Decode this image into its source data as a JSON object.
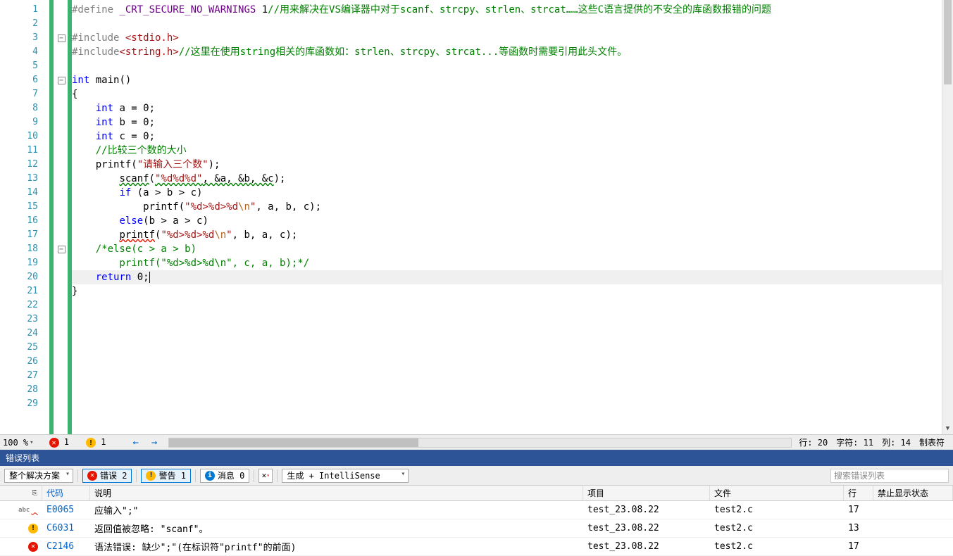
{
  "code": {
    "lines": 29
  },
  "code_tokens": {
    "l1": {
      "define": "#define ",
      "macro": "_CRT_SECURE_NO_WARNINGS",
      "one": " 1",
      "cmt": "//用来解决在VS编译器中对于scanf、strcpy、strlen、strcat……这些C语言提供的不安全的库函数报错的问题"
    },
    "l3": {
      "inc": "#include ",
      "hdr": "<stdio.h>"
    },
    "l4": {
      "inc": "#include",
      "hdr": "<string.h>",
      "cmt": "//这里在使用string相关的库函数如：strlen、strcpy、strcat...等函数时需要引用此头文件。"
    },
    "l6": {
      "int": "int",
      "main": " main()"
    },
    "l7": {
      "brace": "{"
    },
    "l8": {
      "int": "int",
      "rest": " a = 0;"
    },
    "l9": {
      "int": "int",
      "rest": " b = 0;"
    },
    "l10": {
      "int": "int",
      "rest": " c = 0;"
    },
    "l11": {
      "cmt": "//比较三个数的大小"
    },
    "l12": {
      "fn": "printf(",
      "str": "\"请输入三个数\"",
      "end": ");"
    },
    "l13": {
      "scanf": "scanf",
      "paren": "(",
      "fmt": "\"%d%d%d\"",
      "args": ", &a, &b, &c",
      "end": ");"
    },
    "l14": {
      "if": "if ",
      "cond": "(a > b > c)"
    },
    "l15": {
      "fn": "printf(",
      "str": "\"%d>%d>%d",
      "esc": "\\n",
      "strend": "\"",
      "args": ", a, b, c);"
    },
    "l16": {
      "else": "else",
      "cond": "(b > a > c)"
    },
    "l17": {
      "fn": "printf",
      "paren": "(",
      "str": "\"%d>%d>%d",
      "esc": "\\n",
      "strend": "\"",
      "args": ", b, a, c);"
    },
    "l18": {
      "cmt": "/*else(c > a > b)"
    },
    "l19": {
      "cmt": "    printf(\"%d>%d>%d\\n\", c, a, b);*/"
    },
    "l20": {
      "ret": "return",
      "rest": " 0;"
    },
    "l21": {
      "brace": "}"
    }
  },
  "status": {
    "zoom": "100 %",
    "err_count": "1",
    "warn_count": "1",
    "line": "行: 20",
    "char": "字符: 11",
    "col": "列: 14",
    "tabs": "制表符"
  },
  "errorpanel": {
    "title": "错误列表",
    "scope": "整个解决方案",
    "errors_btn": "错误 2",
    "warnings_btn": "警告 1",
    "messages_btn": "消息 0",
    "build_src": "生成 + IntelliSense",
    "search_ph": "搜索错误列表"
  },
  "columns": {
    "code": "代码",
    "desc": "说明",
    "proj": "项目",
    "file": "文件",
    "line": "行",
    "sup": "禁止显示状态"
  },
  "errors": [
    {
      "icon": "abc",
      "code": "E0065",
      "desc": "应输入\";\"",
      "proj": "test_23.08.22",
      "file": "test2.c",
      "line": "17"
    },
    {
      "icon": "warn",
      "code": "C6031",
      "desc": "返回值被忽略: \"scanf\"。",
      "proj": "test_23.08.22",
      "file": "test2.c",
      "line": "13"
    },
    {
      "icon": "err",
      "code": "C2146",
      "desc": "语法错误: 缺少\";\"(在标识符\"printf\"的前面)",
      "proj": "test_23.08.22",
      "file": "test2.c",
      "line": "17"
    }
  ]
}
